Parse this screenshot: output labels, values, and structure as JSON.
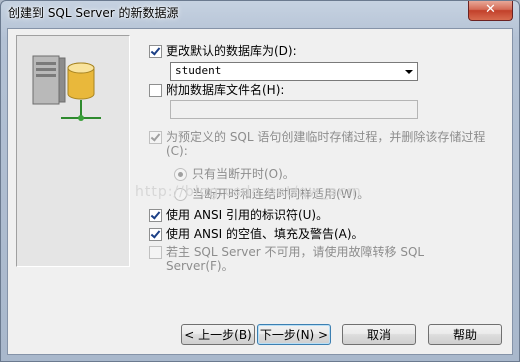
{
  "window": {
    "title": "创建到 SQL Server 的新数据源",
    "close_label": "✕"
  },
  "options": {
    "change_default_db": {
      "label": "更改默认的数据库为(D):",
      "checked": true
    },
    "default_db_value": "student",
    "attach_db_file": {
      "label": "附加数据库文件名(H):",
      "checked": false
    },
    "attach_db_value": "",
    "temp_stored_proc": {
      "label": "为预定义的 SQL 语句创建临时存储过程，并删除该存储过程(C):",
      "checked": true
    },
    "radio_disconnect_only": "只有当断开时(O)。",
    "radio_disconnect_and_connected": "当断开时和连结时同样适用(W)。",
    "ansi_quoted": {
      "label": "使用 ANSI 引用的标识符(U)。",
      "checked": true
    },
    "ansi_nulls": {
      "label": "使用 ANSI 的空值、填充及警告(A)。",
      "checked": true
    },
    "failover": {
      "label": "若主 SQL Server 不可用，请使用故障转移 SQL Server(F)。",
      "checked": false
    }
  },
  "watermark": "http://blog.csdn.net/qw_acm",
  "buttons": {
    "back": "< 上一步(B)",
    "next": "下一步(N) >",
    "cancel": "取消",
    "help": "帮助"
  }
}
